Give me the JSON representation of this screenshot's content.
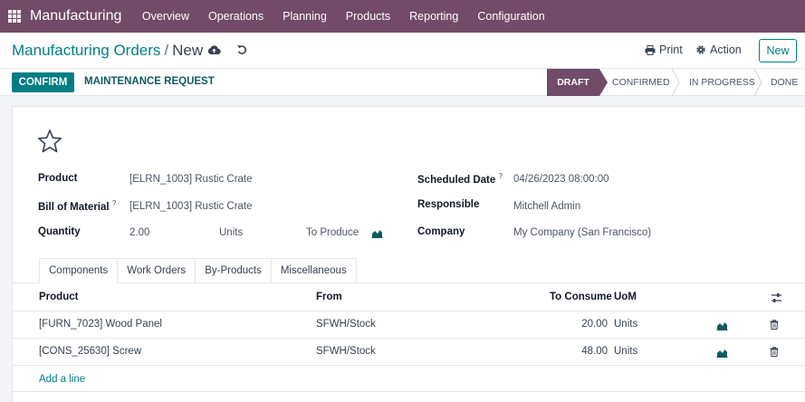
{
  "nav": {
    "app_name": "Manufacturing",
    "items": [
      "Overview",
      "Operations",
      "Planning",
      "Products",
      "Reporting",
      "Configuration"
    ]
  },
  "control": {
    "breadcrumb_parent": "Manufacturing Orders",
    "breadcrumb_sep": "/",
    "breadcrumb_current": "New",
    "print_label": "Print",
    "action_label": "Action",
    "new_label": "New"
  },
  "statusbar": {
    "confirm_label": "CONFIRM",
    "maintenance_label": "MAINTENANCE REQUEST",
    "stages": [
      "DRAFT",
      "CONFIRMED",
      "IN PROGRESS",
      "DONE"
    ],
    "active_stage": "DRAFT"
  },
  "form": {
    "product_label": "Product",
    "product_value": "[ELRN_1003] Rustic Crate",
    "bom_label": "Bill of Material",
    "bom_value": "[ELRN_1003] Rustic Crate",
    "quantity_label": "Quantity",
    "quantity_value": "2.00",
    "quantity_uom": "Units",
    "to_produce_label": "To Produce",
    "scheduled_label": "Scheduled Date",
    "scheduled_value": "04/26/2023 08:00:00",
    "responsible_label": "Responsible",
    "responsible_value": "Mitchell Admin",
    "company_label": "Company",
    "company_value": "My Company (San Francisco)",
    "help_mark": "?"
  },
  "tabs": [
    "Components",
    "Work Orders",
    "By-Products",
    "Miscellaneous"
  ],
  "components": {
    "headers": {
      "product": "Product",
      "from": "From",
      "to_consume": "To Consume",
      "uom": "UoM"
    },
    "rows": [
      {
        "product": "[FURN_7023] Wood Panel",
        "from": "SFWH/Stock",
        "to_consume": "20.00",
        "uom": "Units"
      },
      {
        "product": "[CONS_25630] Screw",
        "from": "SFWH/Stock",
        "to_consume": "48.00",
        "uom": "Units"
      }
    ],
    "add_line": "Add a line"
  },
  "colors": {
    "brand": "#714b67",
    "accent": "#017e84"
  }
}
